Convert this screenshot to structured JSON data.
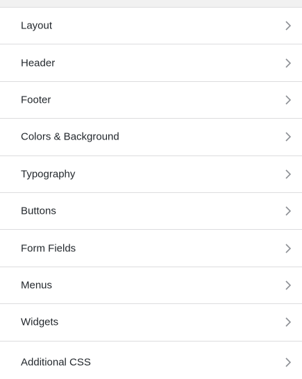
{
  "menu": {
    "items": [
      {
        "label": "Layout"
      },
      {
        "label": "Header"
      },
      {
        "label": "Footer"
      },
      {
        "label": "Colors & Background"
      },
      {
        "label": "Typography"
      },
      {
        "label": "Buttons"
      },
      {
        "label": "Form Fields"
      },
      {
        "label": "Menus"
      },
      {
        "label": "Widgets"
      },
      {
        "label": "Additional CSS"
      }
    ],
    "chevron_icon": "chevron-right-icon",
    "colors": {
      "background": "#f1f1f1",
      "item_background": "#ffffff",
      "divider": "#dcdcde",
      "text": "#23282d",
      "chevron": "#a7aaad"
    }
  }
}
